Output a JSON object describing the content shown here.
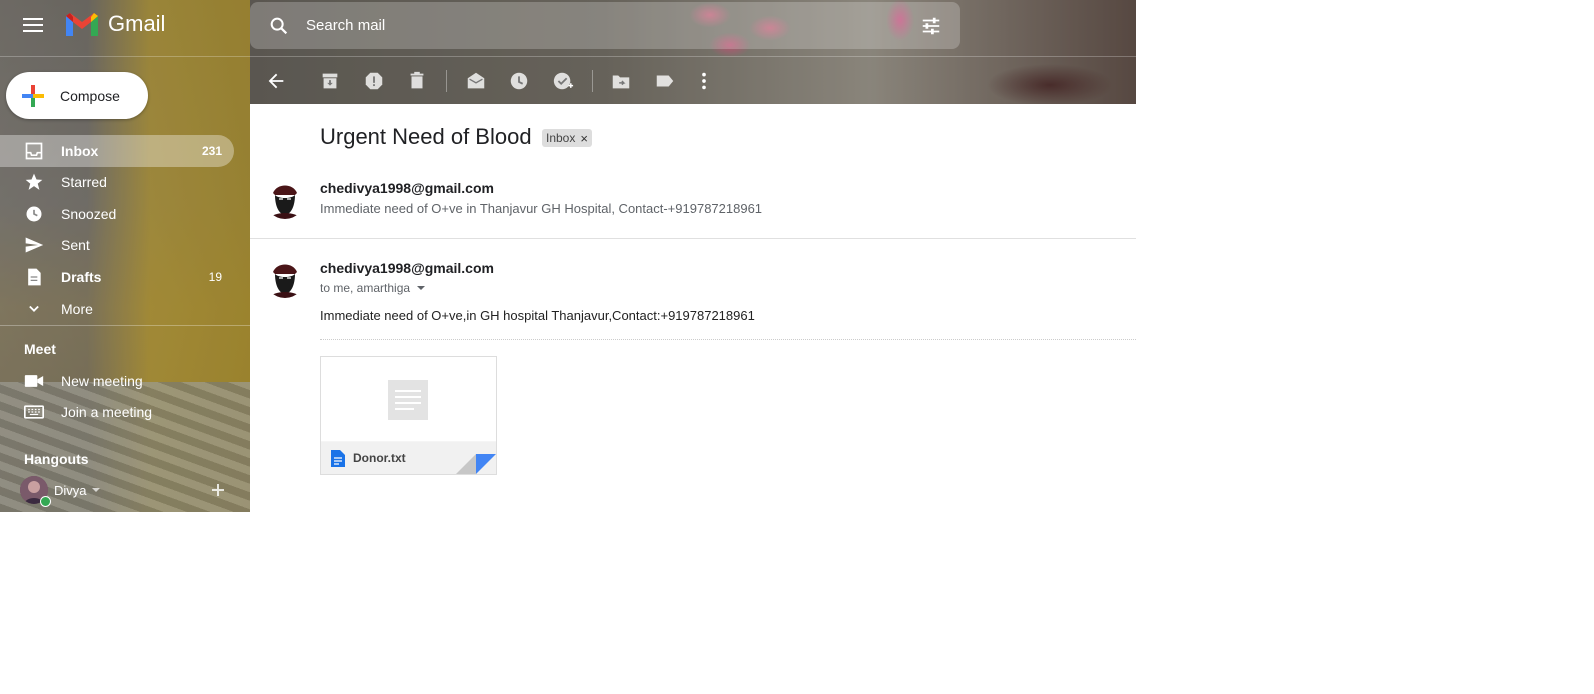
{
  "header": {
    "app_name": "Gmail",
    "search_placeholder": "Search mail"
  },
  "compose": {
    "label": "Compose"
  },
  "sidebar": {
    "items": [
      {
        "label": "Inbox",
        "count": "231",
        "icon": "inbox-icon",
        "active": true
      },
      {
        "label": "Starred",
        "count": "",
        "icon": "star-icon"
      },
      {
        "label": "Snoozed",
        "count": "",
        "icon": "clock-icon"
      },
      {
        "label": "Sent",
        "count": "",
        "icon": "send-icon"
      },
      {
        "label": "Drafts",
        "count": "19",
        "icon": "draft-icon"
      },
      {
        "label": "More",
        "count": "",
        "icon": "chevron-down-icon"
      }
    ],
    "meet": {
      "title": "Meet",
      "items": [
        {
          "label": "New meeting",
          "icon": "video-icon"
        },
        {
          "label": "Join a meeting",
          "icon": "keyboard-icon"
        }
      ]
    },
    "hangouts": {
      "title": "Hangouts",
      "user": "Divya"
    }
  },
  "toolbar": {
    "buttons": [
      "back-icon",
      "archive-icon",
      "report-spam-icon",
      "delete-icon",
      "mark-unread-icon",
      "snooze-icon",
      "add-task-icon",
      "move-to-icon",
      "label-icon",
      "more-icon"
    ]
  },
  "thread": {
    "subject": "Urgent Need of Blood",
    "label_chip": "Inbox",
    "label_chip_close": "×",
    "messages": [
      {
        "sender": "chedivya1998@gmail.com",
        "snippet": "Immediate need of O+ve in Thanjavur GH Hospital, Contact-+919787218961"
      },
      {
        "sender": "chedivya1998@gmail.com",
        "to": "to me, amarthiga",
        "body": "Immediate need of O+ve,in GH hospital Thanjavur,Contact:+919787218961"
      }
    ],
    "attachment": {
      "filename": "Donor.txt"
    }
  },
  "colors": {
    "compose_red": "#ea4335",
    "compose_blue": "#4285f4",
    "compose_green": "#34a853",
    "compose_yellow": "#fbbc04",
    "doc_blue": "#1a73e8"
  }
}
